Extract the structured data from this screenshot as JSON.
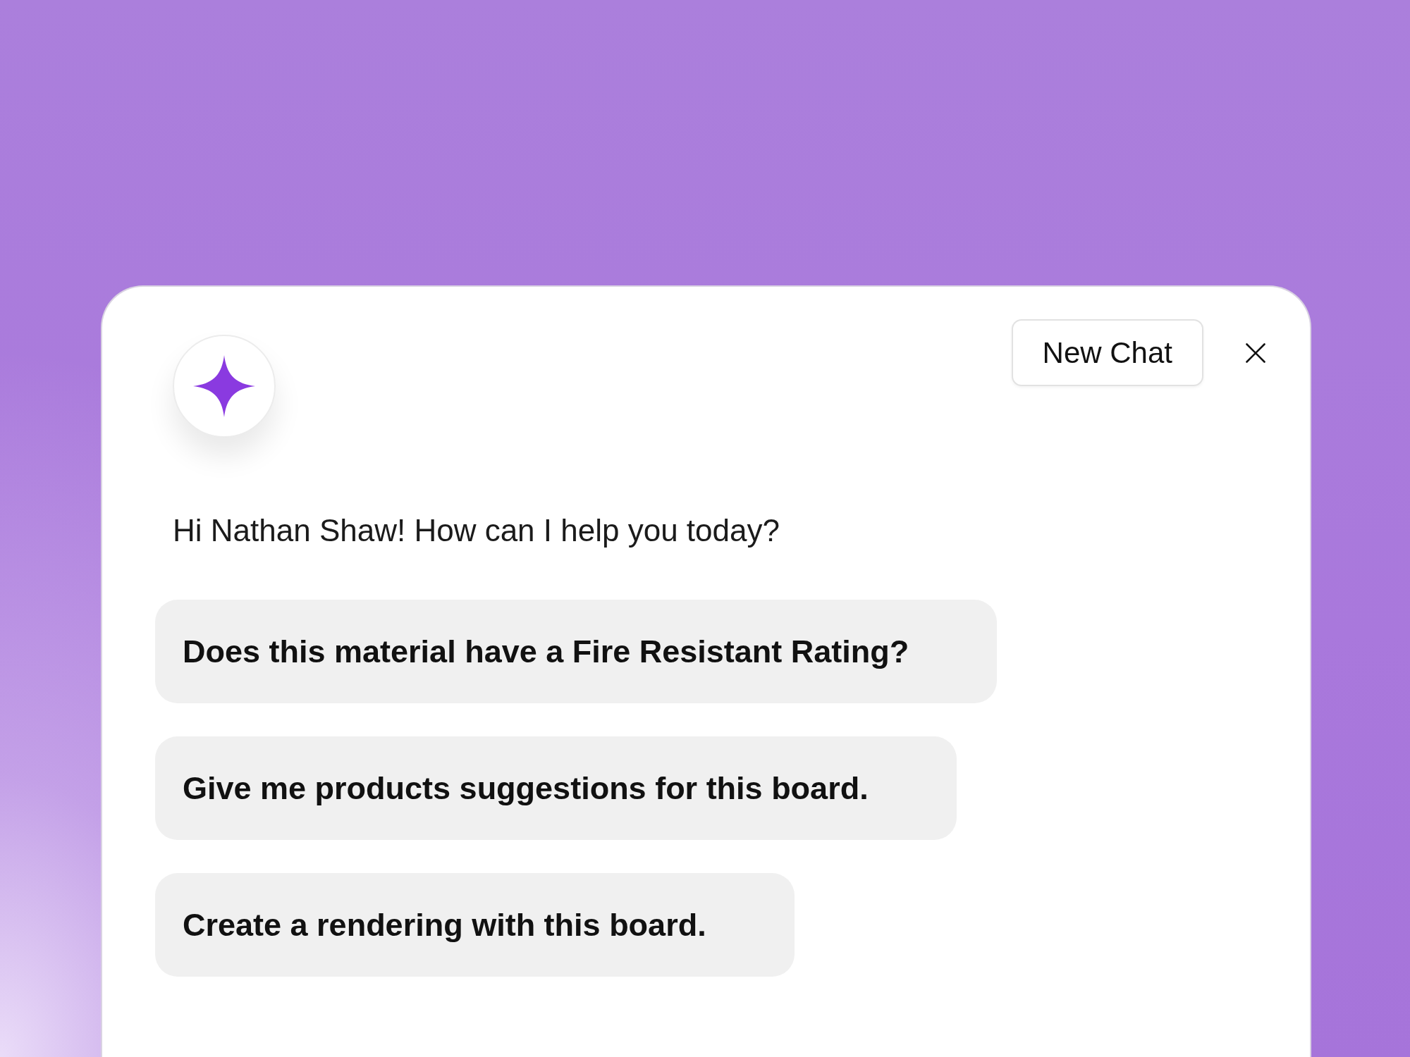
{
  "header": {
    "new_chat_button": {
      "label": "New Chat"
    }
  },
  "greeting": "Hi Nathan Shaw! How can I help you today?",
  "suggestions": [
    {
      "text": "Does this material have a Fire Resistant Rating?"
    },
    {
      "text": "Give me products suggestions for this board."
    },
    {
      "text": "Create a rendering with this board."
    }
  ]
}
